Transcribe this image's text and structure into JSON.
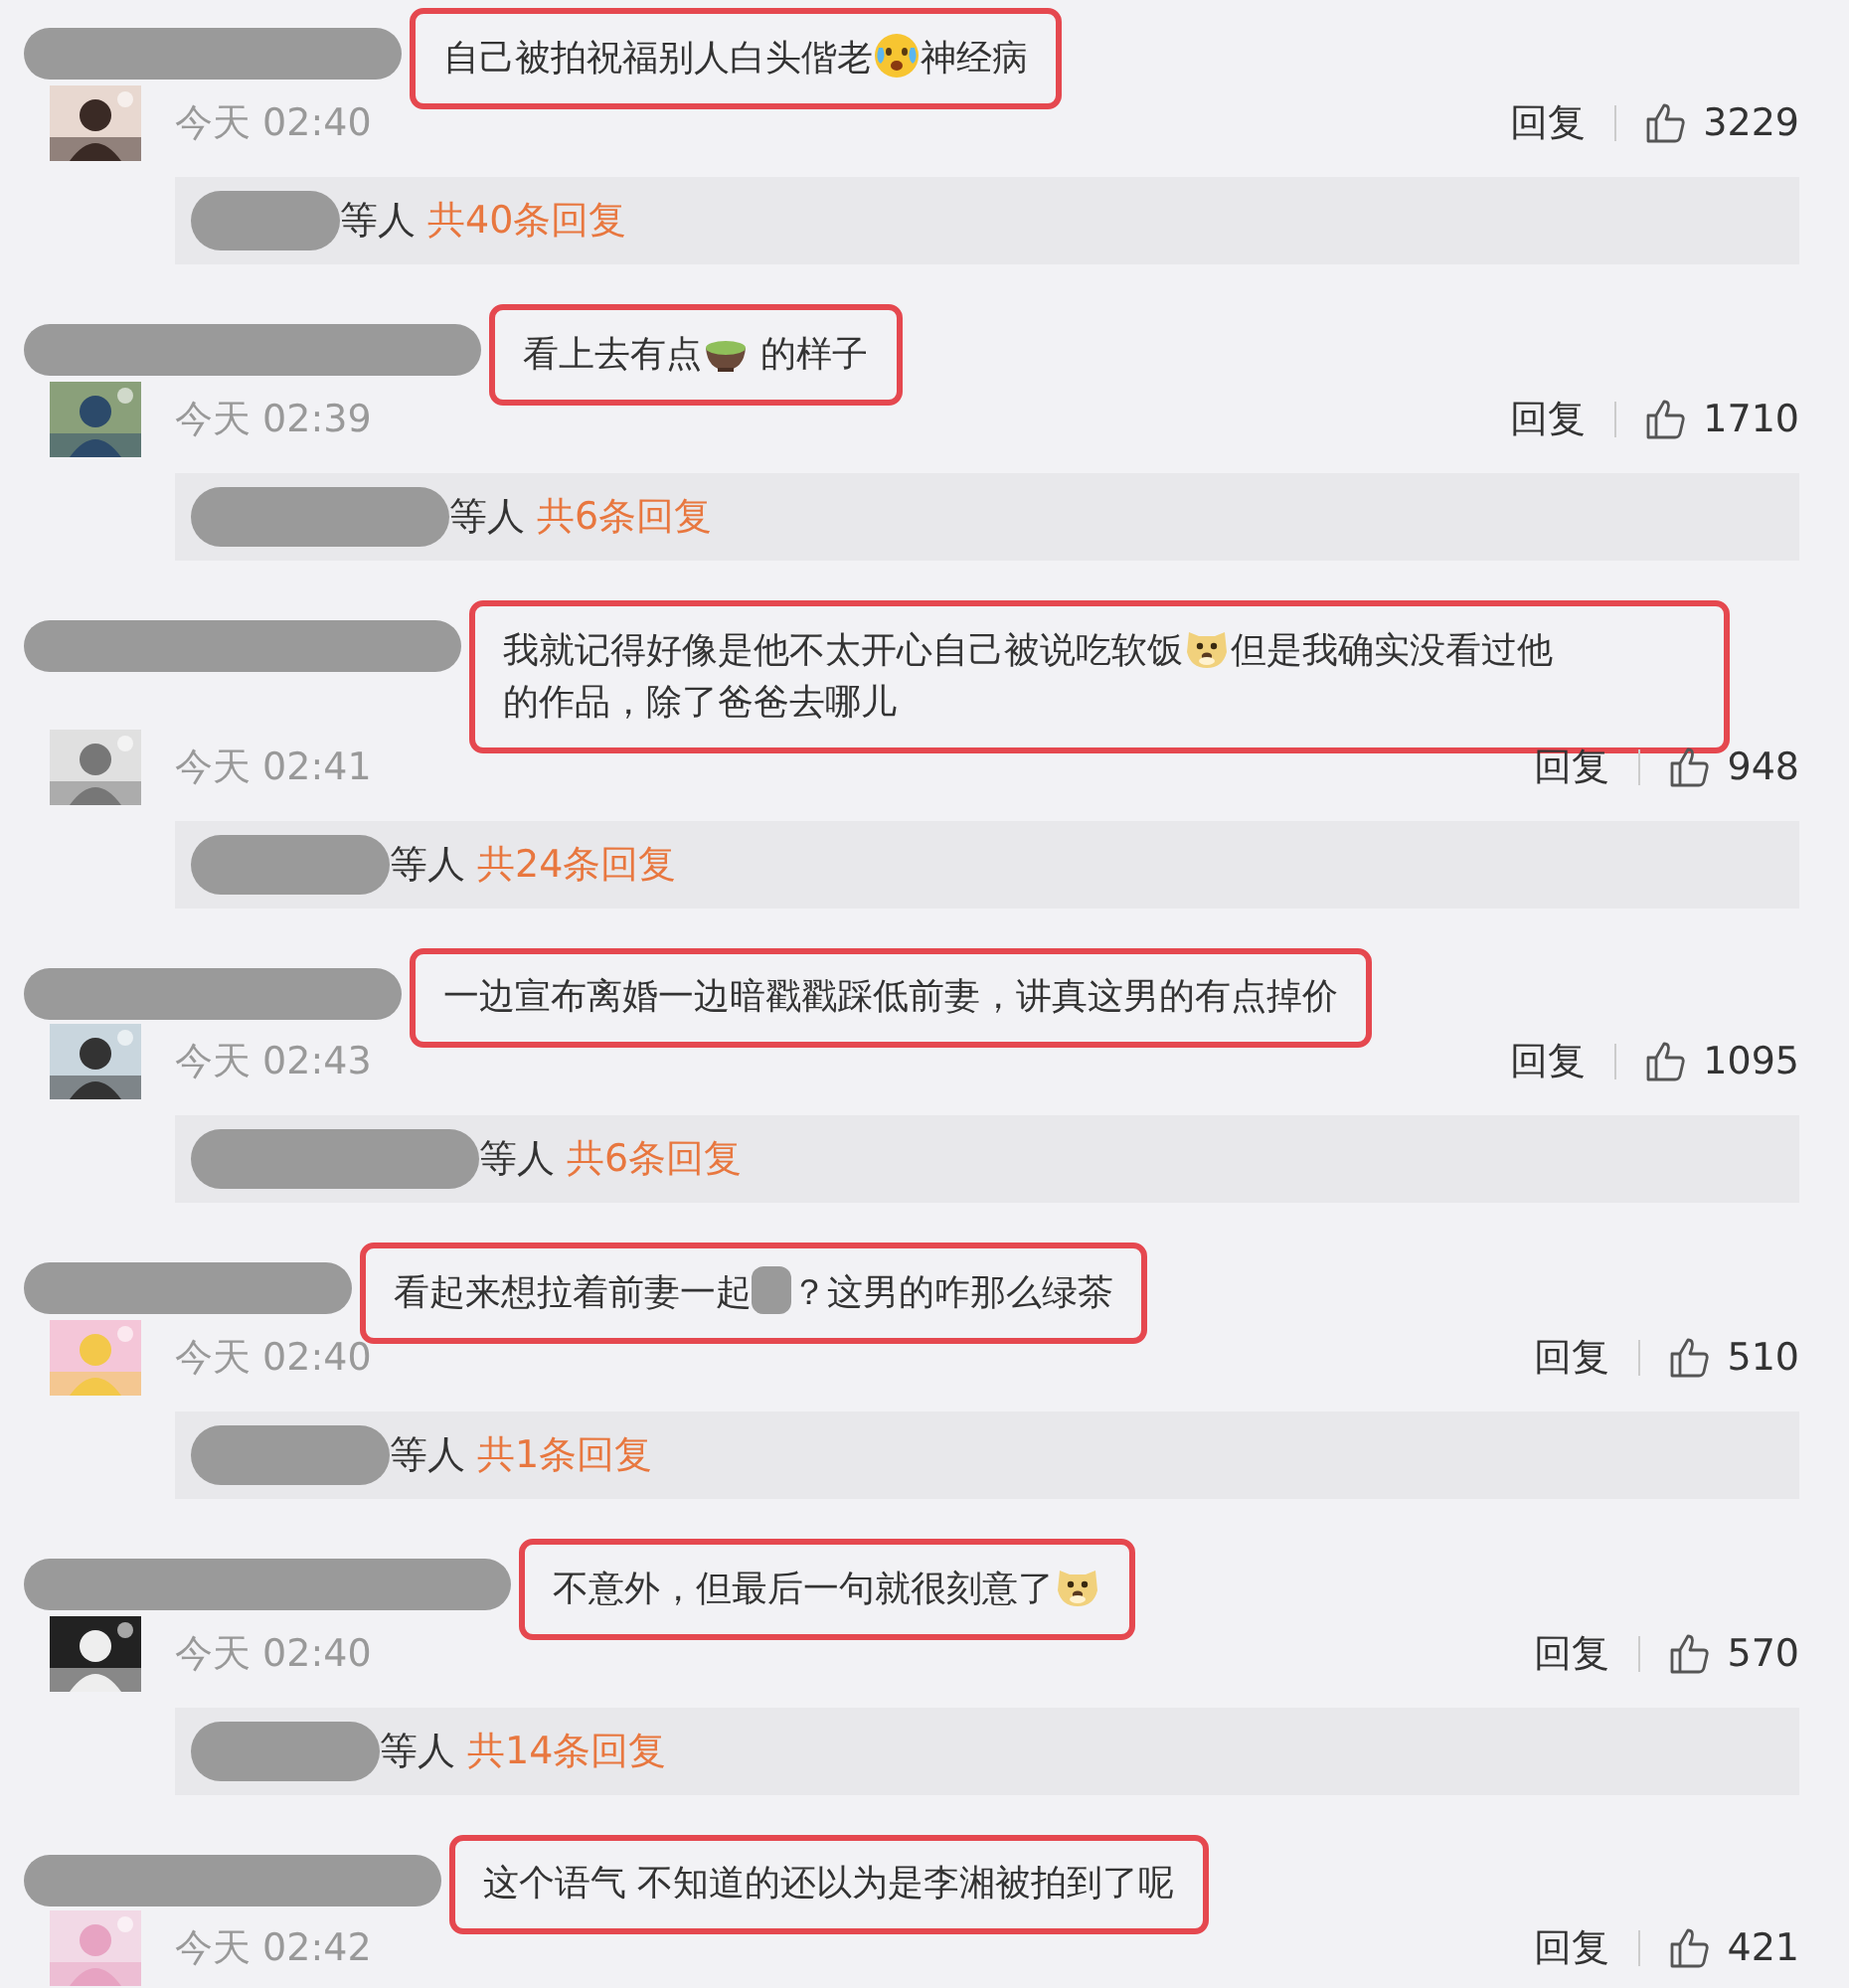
{
  "comments": [
    {
      "parts": [
        {
          "kind": "text",
          "text": "自己被拍祝福别人白头偕老"
        },
        {
          "kind": "cry-emoji"
        },
        {
          "kind": "text",
          "text": "神经病"
        }
      ],
      "time": "今天 02:40",
      "reply_label": "回复",
      "likes": "3229",
      "thread_suffix": "等人",
      "thread_link": "共40条回复"
    },
    {
      "parts": [
        {
          "kind": "text",
          "text": "看上去有点"
        },
        {
          "kind": "tea-emoji"
        },
        {
          "kind": "text",
          "text": " 的样子"
        }
      ],
      "time": "今天 02:39",
      "reply_label": "回复",
      "likes": "1710",
      "thread_suffix": "等人",
      "thread_link": "共6条回复"
    },
    {
      "parts": [
        {
          "kind": "text",
          "text": "我就记得好像是他不太开心自己被说吃软饭"
        },
        {
          "kind": "dog-emoji"
        },
        {
          "kind": "text",
          "text": "但是我确实没看过他"
        },
        {
          "kind": "text",
          "text": "的作品，除了爸爸去哪儿"
        }
      ],
      "time": "今天 02:41",
      "reply_label": "回复",
      "likes": "948",
      "thread_suffix": "等人",
      "thread_link": "共24条回复"
    },
    {
      "parts": [
        {
          "kind": "text",
          "text": "一边宣布离婚一边暗戳戳踩低前妻，讲真这男的有点掉价"
        }
      ],
      "time": "今天 02:43",
      "reply_label": "回复",
      "likes": "1095",
      "thread_suffix": "等人",
      "thread_link": "共6条回复"
    },
    {
      "parts": [
        {
          "kind": "text",
          "text": "看起来想拉着前妻一起"
        },
        {
          "kind": "redacted"
        },
        {
          "kind": "text",
          "text": "？这男的咋那么绿茶"
        }
      ],
      "time": "今天 02:40",
      "reply_label": "回复",
      "likes": "510",
      "thread_suffix": "等人",
      "thread_link": "共1条回复"
    },
    {
      "parts": [
        {
          "kind": "text",
          "text": "不意外，但最后一句就很刻意了"
        },
        {
          "kind": "dog-emoji"
        }
      ],
      "time": "今天 02:40",
      "reply_label": "回复",
      "likes": "570",
      "thread_suffix": "等人",
      "thread_link": "共14条回复"
    },
    {
      "parts": [
        {
          "kind": "text",
          "text": "这个语气 不知道的还以为是李湘被拍到了呢"
        }
      ],
      "time": "今天 02:42",
      "reply_label": "回复",
      "likes": "421"
    }
  ]
}
